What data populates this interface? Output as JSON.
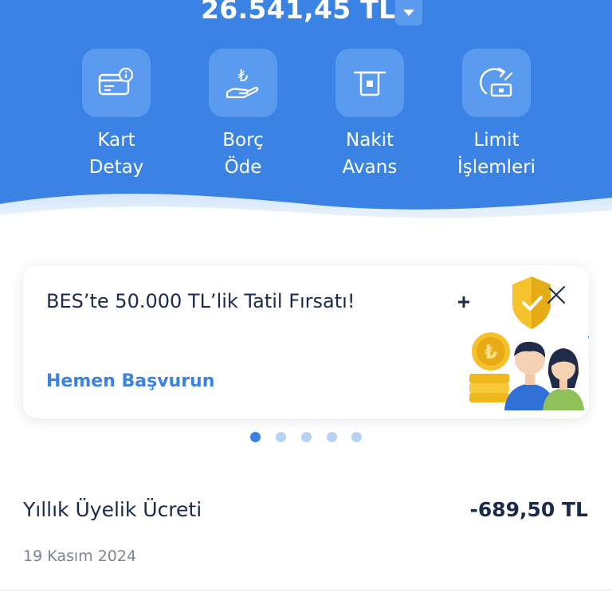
{
  "account": {
    "balance": "26.541,45 TL"
  },
  "actions": [
    {
      "id": "kart-detay",
      "line1": "Kart",
      "line2": "Detay",
      "icon": "card-info-icon"
    },
    {
      "id": "borc-ode",
      "line1": "Borç",
      "line2": "Öde",
      "icon": "lira-hand-icon"
    },
    {
      "id": "nakit-avans",
      "line1": "Nakit",
      "line2": "Avans",
      "icon": "atm-cash-icon"
    },
    {
      "id": "limit-islemleri",
      "line1": "Limit",
      "line2": "İşlemleri",
      "icon": "limit-refresh-icon"
    }
  ],
  "promo": {
    "title": "BES’te 50.000 TL’lik Tatil Fırsatı!",
    "cta": "Hemen Başvurun",
    "close_icon": "close-icon"
  },
  "carousel": {
    "count": 5,
    "active_index": 0
  },
  "transactions": [
    {
      "title": "Yıllık Üyelik Ücreti",
      "amount": "-689,50 TL",
      "date": "19 Kasım 2024"
    }
  ],
  "colors": {
    "primary": "#3a82e4",
    "tile": "#5a9bf0",
    "text_dark": "#1b2a4a",
    "text_muted": "#7a8599"
  }
}
